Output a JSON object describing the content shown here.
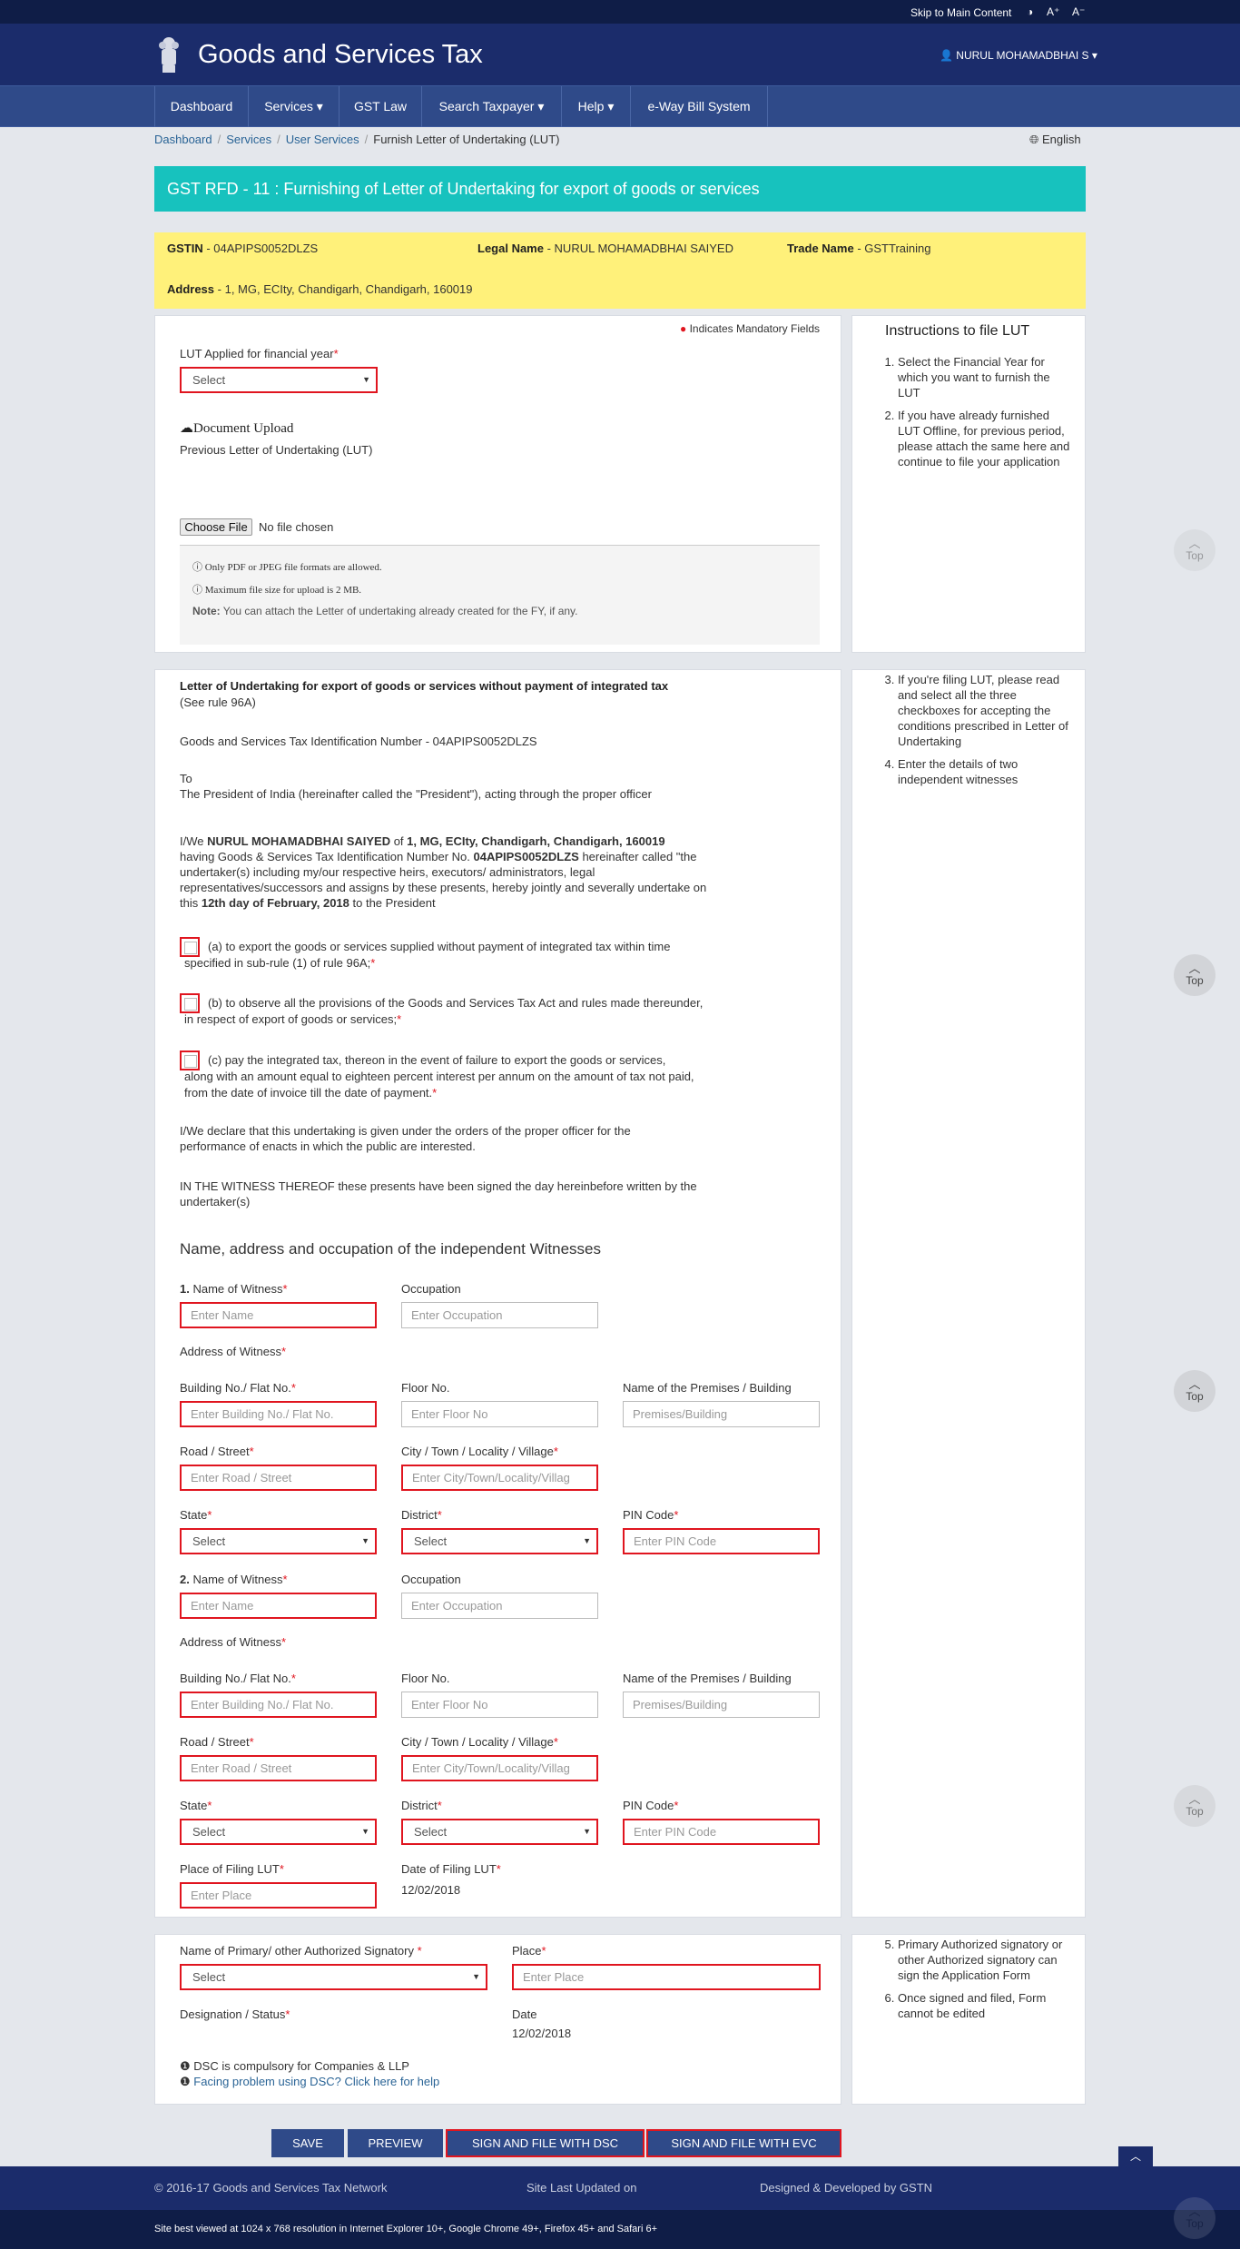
{
  "topbar": {
    "skip": "Skip to Main Content",
    "contrast": "◑",
    "font_up": "A⁺",
    "font_down": "A⁻"
  },
  "header": {
    "title": "Goods and Services Tax",
    "user": "👤 NURUL MOHAMADBHAI S ▾"
  },
  "nav": [
    {
      "label": "Dashboard"
    },
    {
      "label": "Services ▾"
    },
    {
      "label": "GST Law"
    },
    {
      "label": "Search Taxpayer ▾"
    },
    {
      "label": "Help ▾"
    },
    {
      "label": "e-Way Bill System"
    }
  ],
  "breadcrumb": {
    "items": [
      "Dashboard",
      "Services",
      "User Services"
    ],
    "current": "Furnish Letter of Undertaking (LUT)",
    "lang": "English"
  },
  "page_title": "GST RFD - 11 : Furnishing of Letter of Undertaking for export of goods or services",
  "info": {
    "gstin_label": "GSTIN",
    "gstin": " - 04APIPS0052DLZS",
    "legal_label": "Legal Name",
    "legal": " - NURUL MOHAMADBHAI SAIYED",
    "trade_label": "Trade Name",
    "trade": " - GSTTraining",
    "address_label": "Address",
    "address": " - 1, MG, ECIty, Chandigarh, Chandigarh, 160019"
  },
  "section1": {
    "mandatory": "Indicates Mandatory Fields",
    "fy_label": "LUT Applied for financial year",
    "fy_select": "Select",
    "doc_upload": "Document Upload",
    "prev_lut": "Previous Letter of Undertaking (LUT)",
    "choose_file": "Choose File",
    "no_file": "No file chosen",
    "note1": "Only PDF or JPEG file formats are allowed.",
    "note2": "Maximum file size for upload is 2 MB.",
    "note3_label": "Note:",
    "note3": " You can attach the Letter of undertaking already created for the FY, if any."
  },
  "instructions": {
    "title": "Instructions to file LUT",
    "i1": "Select the Financial Year for which you want to furnish the LUT",
    "i2": "If you have already furnished LUT Offline, for previous period, please attach the same here and continue to file your application",
    "i3": "If you're filing LUT, please read and select all the three checkboxes for accepting the conditions prescribed in Letter of Undertaking",
    "i4": "Enter the details of two independent witnesses",
    "i5": "Primary Authorized signatory or other Authorized signatory can sign the Application Form",
    "i6": "Once signed and filed, Form cannot be edited"
  },
  "lut": {
    "heading": "Letter of Undertaking for export of goods or services without payment of integrated tax",
    "rule": "(See rule 96A)",
    "gstin_line": "Goods and Services Tax Identification Number - 04APIPS0052DLZS",
    "to": "To",
    "president": "The President of India (hereinafter called the \"President\"), acting through the proper officer",
    "p1_a": "I/We ",
    "p1_name": "NURUL MOHAMADBHAI SAIYED",
    "p1_b": " of ",
    "p1_addr": "1, MG, ECIty, Chandigarh, Chandigarh, 160019",
    "p1_c": "having Goods & Services Tax Identification Number No. ",
    "p1_gstin": "04APIPS0052DLZS",
    "p1_d": " hereinafter called \"the",
    "p1_e": "undertaker(s) including my/our respective heirs, executors/ administrators, legal",
    "p1_f": "representatives/successors and assigns by these presents, hereby jointly and severally undertake on",
    "p1_g": "this ",
    "p1_date": "12th day of February, 2018",
    "p1_h": " to the President",
    "ca1": "(a) to export the goods or services supplied without payment of integrated tax within time",
    "ca2": "specified in sub-rule (1) of rule 96A;",
    "cb1": "(b) to observe all the provisions of the Goods and Services Tax Act and rules made thereunder,",
    "cb2": "in respect of export of goods or services;",
    "cc1": "(c) pay the integrated tax, thereon in the event of failure to export the goods or services,",
    "cc2": "along with an amount equal to eighteen percent interest per annum on the amount of tax not paid,",
    "cc3": "from the date of invoice till the date of payment.",
    "decl1": "I/We declare that this undertaking is given under the orders of the proper officer for the",
    "decl2": "performance of enacts in which the public are interested.",
    "wit1": "IN THE WITNESS THEREOF these presents have been signed the day hereinbefore written by the",
    "wit2": "undertaker(s)"
  },
  "witnesses": {
    "heading": "Name, address and occupation of the independent Witnesses",
    "w1_num": "1.",
    "w2_num": "2.",
    "name_label": "Name of Witness",
    "occ_label": "Occupation",
    "addr_label": "Address of Witness",
    "bldg_label": "Building No./ Flat No.",
    "floor_label": "Floor No.",
    "premises_label": "Name of the Premises / Building",
    "road_label": "Road / Street",
    "city_label": "City / Town / Locality / Village",
    "state_label": "State",
    "district_label": "District",
    "pin_label": "PIN Code",
    "ph_name": "Enter Name",
    "ph_occ": "Enter Occupation",
    "ph_bldg": "Enter Building No./ Flat No.",
    "ph_floor": "Enter Floor No",
    "ph_premises": "Premises/Building",
    "ph_road": "Enter Road / Street",
    "ph_city": "Enter City/Town/Locality/Villag",
    "ph_pin": "Enter PIN Code",
    "select": "Select",
    "place_label": "Place of Filing LUT",
    "place_ph": "Enter Place",
    "date_label": "Date of Filing LUT",
    "date_val": "12/02/2018"
  },
  "signatory": {
    "name_label": "Name of Primary/ other Authorized Signatory",
    "select": "Select",
    "place_label": "Place",
    "place_ph": "Enter Place",
    "desig_label": "Designation / Status",
    "date_label": "Date",
    "date_val": "12/02/2018",
    "dsc1": "DSC is compulsory for Companies & LLP",
    "dsc2": "Facing problem using DSC? Click here for help"
  },
  "buttons": {
    "save": "SAVE",
    "preview": "PREVIEW",
    "dsc": "SIGN AND FILE WITH DSC",
    "evc": "SIGN AND FILE WITH EVC"
  },
  "top_label": "Top",
  "footer": {
    "copyright": "© 2016-17 Goods and Services Tax Network",
    "updated": "Site Last Updated on",
    "designed": "Designed & Developed by GSTN",
    "best": "Site best viewed at 1024 x 768 resolution in Internet Explorer 10+, Google Chrome 49+, Firefox 45+ and Safari 6+"
  },
  "colors": {
    "header": "#1b2c6b",
    "nav": "#2f4a89",
    "title_bar": "#17c2be",
    "info_bar": "#fff17a",
    "error": "#e0151f"
  }
}
